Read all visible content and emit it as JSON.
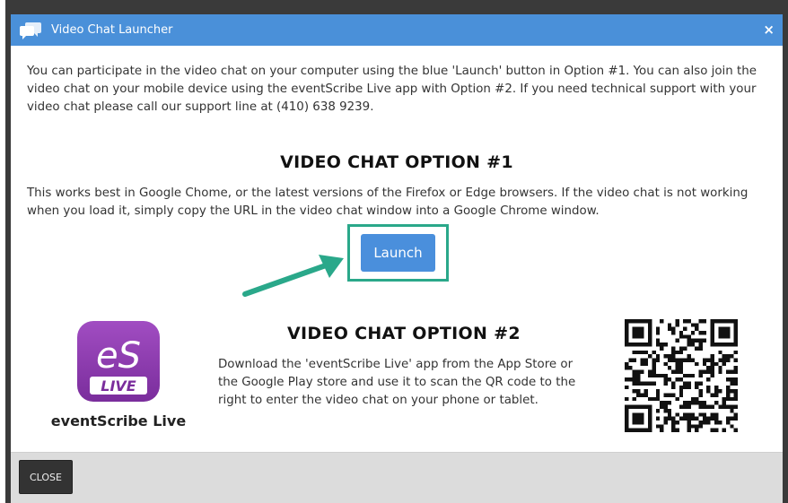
{
  "dialog": {
    "title": "Video Chat Launcher",
    "close_symbol": "×"
  },
  "intro": {
    "text": "You can participate in the video chat on your computer using the blue 'Launch' button in Option #1. You can also join the video chat on your mobile device using the eventScribe Live app with Option #2. If you need technical support with your video chat please call our support line at (410) 638 9239."
  },
  "option1": {
    "heading": "VIDEO CHAT OPTION #1",
    "description": "This works best in Google Chome, or the latest versions of the Firefox or Edge browsers. If the video chat is not working when you load it, simply copy the URL in the video chat window into a Google Chrome window.",
    "launch_label": "Launch"
  },
  "option2": {
    "heading": "VIDEO CHAT OPTION #2",
    "description": "Download the 'eventScribe Live' app from the App Store or the Google Play store and use it to scan the QR code to the right to enter the video chat on your phone or tablet.",
    "app_name": "eventScribe Live",
    "app_icon_text": "eS",
    "app_icon_subtext": "LIVE"
  },
  "footer": {
    "close_label": "CLOSE"
  },
  "colors": {
    "titlebar": "#4a90d9",
    "launch_button": "#4a8fdc",
    "highlight": "#2aa88a",
    "app_icon": "#8e3fb0"
  },
  "icons": {
    "title": "chat-bubbles-icon",
    "close": "close-icon",
    "arrow": "arrow-icon",
    "qr": "qr-code"
  }
}
